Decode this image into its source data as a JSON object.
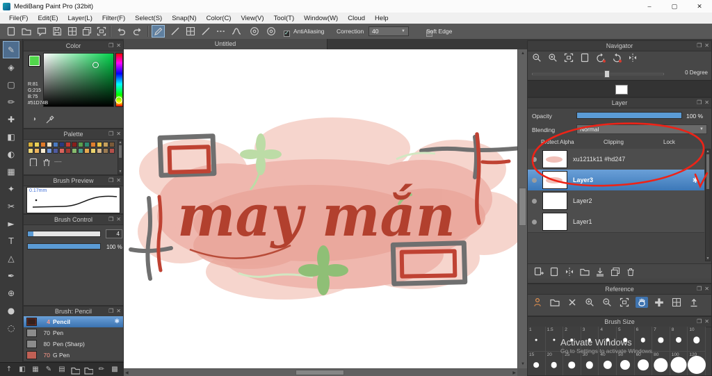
{
  "window": {
    "title": "MediBang Paint Pro (32bit)",
    "controls": {
      "minimize": "–",
      "maximize": "▢",
      "close": "✕"
    }
  },
  "menu": {
    "items": [
      "File(F)",
      "Edit(E)",
      "Layer(L)",
      "Filter(F)",
      "Select(S)",
      "Snap(N)",
      "Color(C)",
      "View(V)",
      "Tool(T)",
      "Window(W)",
      "Cloud",
      "Help"
    ]
  },
  "toolbar": {
    "antialiasing_label": "AntiAliasing",
    "correction_label": "Correction",
    "correction_value": "40",
    "soft_edge_label": "Soft Edge"
  },
  "color_panel": {
    "title": "Color",
    "r_label": "R:81",
    "g_label": "G:215",
    "b_label": "B:75",
    "hex_label": "#51D74B",
    "foreground_color": "#51D74B"
  },
  "palette_panel": {
    "title": "Palette",
    "note": "----",
    "swatches": [
      "#d9b13b",
      "#e8cf56",
      "#df7a2a",
      "#f2e3c0",
      "#4a7ac0",
      "#2a3a7e",
      "#c23a30",
      "#871f1c",
      "#5aa04e",
      "#2f8a70",
      "#de7e2f",
      "#e7bf45",
      "#c6a05c",
      "#7a5a38",
      "#eed878",
      "#edb45c",
      "#f7ecd2",
      "#6e93d6",
      "#4f5ba0",
      "#d9635c",
      "#a33a33",
      "#86bb6e",
      "#4d9f8d",
      "#e8a94e",
      "#ead26e",
      "#d4b489",
      "#9b7b52",
      "#b4504a"
    ]
  },
  "brush_preview_panel": {
    "title": "Brush Preview",
    "size": "0.17mm"
  },
  "brush_control_panel": {
    "title": "Brush Control",
    "size_value": "4",
    "opacity_value": "100 %"
  },
  "brush_list_panel": {
    "title": "Brush: Pencil",
    "brushes": [
      {
        "size": "4",
        "name": "Pencil",
        "selected": true
      },
      {
        "size": "70",
        "name": "Pen",
        "selected": false
      },
      {
        "size": "80",
        "name": "Pen (Sharp)",
        "selected": false
      },
      {
        "size": "70",
        "name": "G Pen",
        "selected": false
      }
    ]
  },
  "canvas": {
    "tab_label": "Untitled",
    "artwork_text": "may mắn",
    "colors": {
      "blob_light": "#f6d3cb",
      "blob": "#efb4aa",
      "blob_dark": "#e9a296",
      "text": "#b2402e",
      "gray": "#6f6f6f",
      "red": "#bf4233",
      "green_light": "#bcdca6",
      "green": "#8fbf76",
      "green_pale": "#d2e7c2"
    }
  },
  "navigator_panel": {
    "title": "Navigator",
    "rotation_label": "0 Degree"
  },
  "layer_panel": {
    "title": "Layer",
    "opacity_label": "Opacity",
    "opacity_value": "100 %",
    "blending_label": "Blending",
    "blending_value": "Normal",
    "protect_alpha_label": "Protect Alpha",
    "clipping_label": "Clipping",
    "lock_label": "Lock",
    "layers": [
      {
        "name": "xu1211k11 #hd247",
        "selected": false
      },
      {
        "name": "Layer3",
        "selected": true
      },
      {
        "name": "Layer2",
        "selected": false
      },
      {
        "name": "Layer1",
        "selected": false
      }
    ]
  },
  "reference_panel": {
    "title": "Reference"
  },
  "brush_size_panel": {
    "title": "Brush Size",
    "row1": [
      "1",
      "1.5",
      "2",
      "3",
      "4",
      "5",
      "6",
      "7",
      "8",
      "10"
    ],
    "row2": [
      "15",
      "20",
      "25",
      "30",
      "40",
      "50",
      "60",
      "80",
      "100",
      "120"
    ]
  },
  "annotation": {
    "color": "#ed2317"
  },
  "watermark": {
    "line1": "Activate Windows",
    "line2": "Go to Settings to activate Windows."
  },
  "ui_colors": {
    "selection_blue": "#4a86c8",
    "slider_blue": "#5b9bd5"
  }
}
